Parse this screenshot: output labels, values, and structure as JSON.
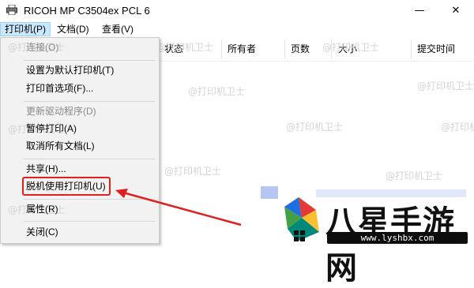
{
  "window": {
    "title": "RICOH MP C3504ex PCL 6",
    "minimize_glyph": "—",
    "close_glyph": "✕"
  },
  "menubar": [
    {
      "label": "打印机(P)"
    },
    {
      "label": "文档(D)"
    },
    {
      "label": "查看(V)"
    }
  ],
  "columns": [
    "状态",
    "所有者",
    "页数",
    "大小",
    "提交时间"
  ],
  "printer_menu": {
    "items": [
      {
        "label": "连接(O)",
        "disabled": true
      },
      {
        "label": "设置为默认打印机(T)",
        "disabled": false
      },
      {
        "label": "打印首选项(F)...",
        "disabled": false
      },
      {
        "label": "更新驱动程序(D)",
        "disabled": true
      },
      {
        "label": "暂停打印(A)",
        "disabled": false
      },
      {
        "label": "取消所有文档(L)",
        "disabled": false
      },
      {
        "label": "共享(H)...",
        "disabled": false
      },
      {
        "label": "脱机使用打印机(U)",
        "disabled": false,
        "highlighted": true
      },
      {
        "label": "属性(R)",
        "disabled": false
      },
      {
        "label": "关闭(C)",
        "disabled": false
      }
    ]
  },
  "watermark": {
    "text": "@打印机卫士"
  },
  "logo": {
    "name": "八星手游网",
    "url": "www.lyshbx.com"
  },
  "colors": {
    "highlight": "#e02020",
    "menu_bg": "#f2f2f2",
    "menu_active": "#cce8ff"
  }
}
